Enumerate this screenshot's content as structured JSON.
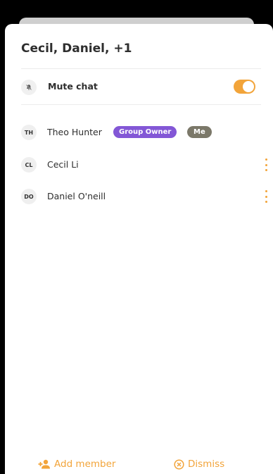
{
  "dialog": {
    "title": "Cecil, Daniel, +1"
  },
  "mute": {
    "label": "Mute chat",
    "enabled": true,
    "icon": "bell-off-icon"
  },
  "members": [
    {
      "initials": "TH",
      "name": "Theo Hunter",
      "badges": [
        "Group Owner",
        "Me"
      ]
    },
    {
      "initials": "CL",
      "name": "Cecil Li",
      "has_menu": true
    },
    {
      "initials": "DO",
      "name": "Daniel O'neill",
      "has_menu": true
    }
  ],
  "footer": {
    "add_label": "Add member",
    "add_icon": "add-person-icon",
    "dismiss_label": "Dismiss",
    "dismiss_icon": "close-circle-icon"
  },
  "colors": {
    "accent": "#f2a43a",
    "owner_badge": "#8357d6",
    "me_badge": "#7b7869"
  }
}
